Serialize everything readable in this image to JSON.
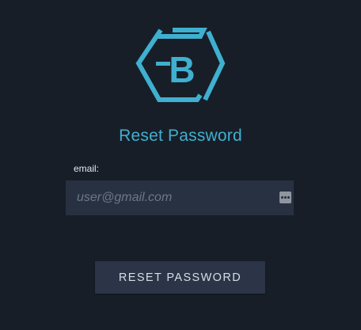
{
  "logo": {
    "icon": "hexagon-b-logo",
    "letter": "B",
    "color": "#3fb0cf"
  },
  "title": "Reset Password",
  "form": {
    "email_label": "email:",
    "email_placeholder": "user@gmail.com",
    "email_value": "",
    "field_icon": "password-manager-icon"
  },
  "submit_label": "RESET PASSWORD",
  "colors": {
    "background": "#181e28",
    "accent": "#3fb0cf",
    "input_bg": "#283142",
    "button_bg": "#2b3547"
  }
}
